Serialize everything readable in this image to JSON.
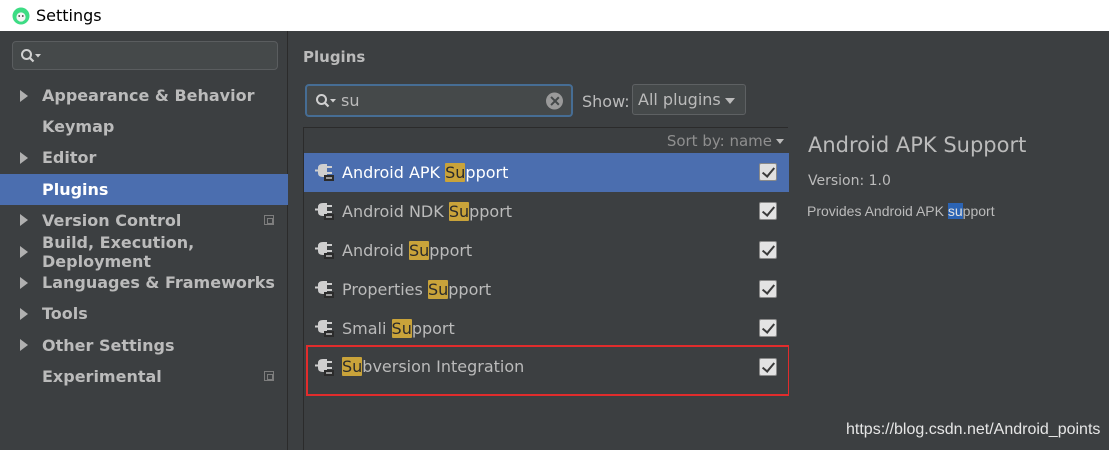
{
  "window": {
    "title": "Settings",
    "app_icon": "android-studio-icon"
  },
  "sidebar": {
    "search_icon": "search-icon",
    "items": [
      {
        "label": "Appearance & Behavior",
        "expandable": true,
        "project_icon": false,
        "selected": false
      },
      {
        "label": "Keymap",
        "expandable": false,
        "project_icon": false,
        "selected": false
      },
      {
        "label": "Editor",
        "expandable": true,
        "project_icon": false,
        "selected": false
      },
      {
        "label": "Plugins",
        "expandable": false,
        "project_icon": false,
        "selected": true
      },
      {
        "label": "Version Control",
        "expandable": true,
        "project_icon": true,
        "selected": false
      },
      {
        "label": "Build, Execution, Deployment",
        "expandable": true,
        "project_icon": false,
        "selected": false
      },
      {
        "label": "Languages & Frameworks",
        "expandable": true,
        "project_icon": false,
        "selected": false
      },
      {
        "label": "Tools",
        "expandable": true,
        "project_icon": false,
        "selected": false
      },
      {
        "label": "Other Settings",
        "expandable": true,
        "project_icon": false,
        "selected": false
      },
      {
        "label": "Experimental",
        "expandable": false,
        "project_icon": true,
        "selected": false
      }
    ]
  },
  "main": {
    "heading": "Plugins",
    "search": {
      "value": "su"
    },
    "show": {
      "label": "Show:",
      "selected": "All plugins"
    },
    "sort_by": "Sort by: name",
    "plugins": [
      {
        "prefix": "Android APK ",
        "match": "Su",
        "suffix": "pport",
        "checked": true,
        "selected": true
      },
      {
        "prefix": "Android NDK ",
        "match": "Su",
        "suffix": "pport",
        "checked": true,
        "selected": false
      },
      {
        "prefix": "Android ",
        "match": "Su",
        "suffix": "pport",
        "checked": true,
        "selected": false
      },
      {
        "prefix": "Properties ",
        "match": "Su",
        "suffix": "pport",
        "checked": true,
        "selected": false
      },
      {
        "prefix": "Smali ",
        "match": "Su",
        "suffix": "pport",
        "checked": true,
        "selected": false
      },
      {
        "prefix": "",
        "match": "Su",
        "suffix": "bversion Integration",
        "checked": true,
        "selected": false
      }
    ]
  },
  "detail": {
    "title": "Android APK Support",
    "version": "Version: 1.0",
    "desc_prefix": "Provides Android APK ",
    "desc_match": "su",
    "desc_suffix": "pport"
  },
  "watermark": "https://blog.csdn.net/Android_points",
  "colors": {
    "selection": "#4b6eaf",
    "highlight": "#c9a33a",
    "annotation_frame": "#e12c2c"
  }
}
